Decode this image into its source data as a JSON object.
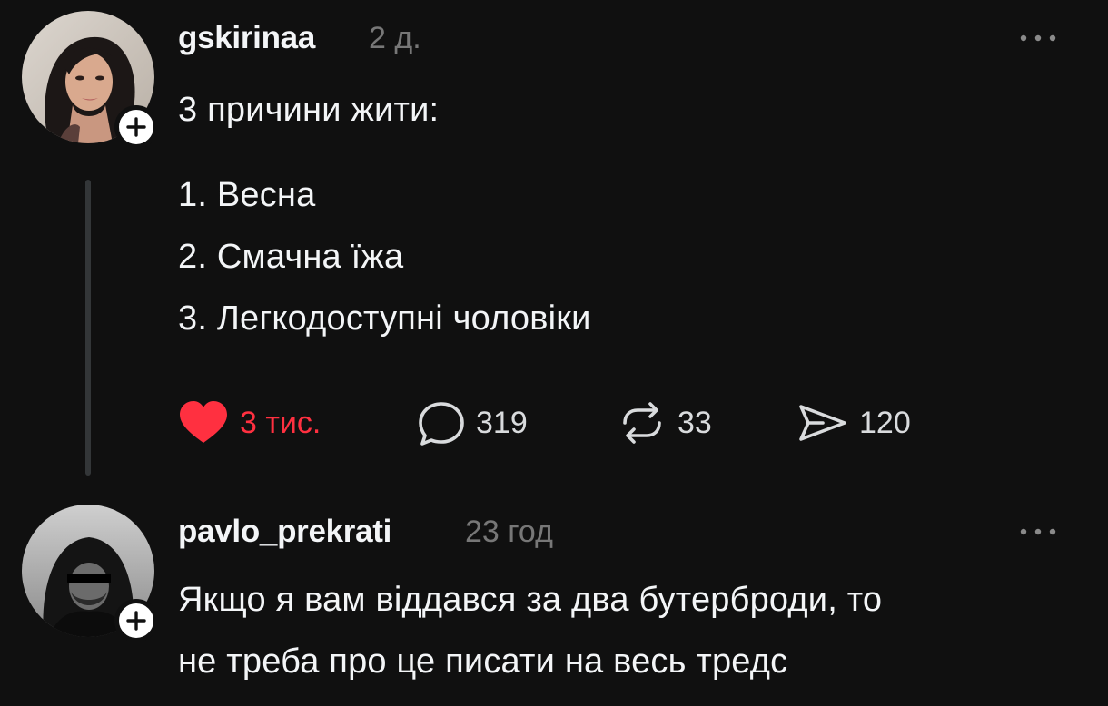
{
  "posts": [
    {
      "username": "gskirinaa",
      "time": "2 д.",
      "lines": [
        "3 причини жити:",
        "1. Весна",
        "2. Смачна їжа",
        "3. Легкодоступні чоловіки"
      ],
      "actions": {
        "likes": "3 тис.",
        "replies": "319",
        "reposts": "33",
        "shares": "120"
      },
      "liked": true
    },
    {
      "username": "pavlo_prekrati",
      "time": "23 год",
      "lines": [
        "Якщо я вам віддався за два бутерброди, то",
        "не треба про це писати на весь тредс"
      ]
    }
  ],
  "colors": {
    "background": "#101010",
    "like_red": "#ff3040",
    "text": "#f3f5f7",
    "muted": "#777777",
    "thread_line": "#333638"
  },
  "icons": [
    "heart-icon",
    "reply-bubble-icon",
    "repost-icon",
    "share-send-icon",
    "more-icon",
    "plus-icon"
  ]
}
